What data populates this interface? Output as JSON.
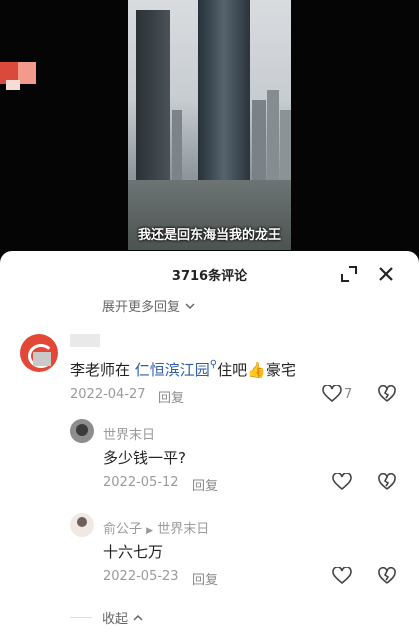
{
  "video": {
    "caption": "我还是回东海当我的龙王"
  },
  "sheet": {
    "title": "3716条评论",
    "expand_more": "展开更多回复",
    "collapse": "收起"
  },
  "comments": [
    {
      "text_prefix": "李老师在 ",
      "link": "仁恒滨江园",
      "text_suffix": "住吧",
      "emoji": "👍",
      "text_end": "豪宅",
      "date": "2022-04-27",
      "reply": "回复",
      "likes": "7"
    },
    {
      "user": "世界末日",
      "text": "多少钱一平?",
      "date": "2022-05-12",
      "reply": "回复"
    },
    {
      "user": "俞公子",
      "reply_to": "世界末日",
      "text": "十六七万",
      "date": "2022-05-23",
      "reply": "回复"
    }
  ],
  "colors": {
    "link": "#2f5ea8",
    "meta": "#9a9a9a"
  }
}
